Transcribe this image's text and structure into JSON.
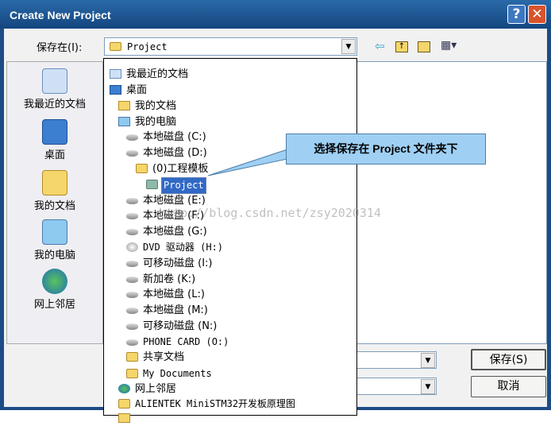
{
  "window": {
    "title": "Create New Project",
    "help": "?",
    "close": "✕"
  },
  "toolbar": {
    "savein_label": "保存在(I):",
    "savein_value": "Project",
    "icons": [
      "back-arrow-icon",
      "up-folder-icon",
      "new-folder-icon",
      "view-menu-icon"
    ]
  },
  "places": [
    {
      "label": "我最近的文档",
      "icon": "recent-docs-icon"
    },
    {
      "label": "桌面",
      "icon": "desktop-icon"
    },
    {
      "label": "我的文档",
      "icon": "my-documents-icon"
    },
    {
      "label": "我的电脑",
      "icon": "my-computer-icon"
    },
    {
      "label": "网上邻居",
      "icon": "network-icon"
    }
  ],
  "tree": [
    {
      "label": "我最近的文档",
      "icon": "recent-docs"
    },
    {
      "label": "桌面",
      "icon": "desktop"
    },
    {
      "label": "我的文档",
      "icon": "my-documents"
    },
    {
      "label": "我的电脑",
      "icon": "my-computer"
    },
    {
      "label": "本地磁盘 (C:)",
      "icon": "drive"
    },
    {
      "label": "本地磁盘 (D:)",
      "icon": "drive"
    },
    {
      "label": "(0)工程模板",
      "icon": "folder"
    },
    {
      "label": "Project",
      "icon": "folder-open",
      "selected": true
    },
    {
      "label": "本地磁盘 (E:)",
      "icon": "drive"
    },
    {
      "label": "本地磁盘 (F:)",
      "icon": "drive"
    },
    {
      "label": "本地磁盘 (G:)",
      "icon": "drive"
    },
    {
      "label": "DVD 驱动器 (H:)",
      "icon": "dvd"
    },
    {
      "label": "可移动磁盘 (I:)",
      "icon": "drive"
    },
    {
      "label": "新加卷 (K:)",
      "icon": "drive"
    },
    {
      "label": "本地磁盘 (L:)",
      "icon": "drive"
    },
    {
      "label": "本地磁盘 (M:)",
      "icon": "drive"
    },
    {
      "label": "可移动磁盘 (N:)",
      "icon": "drive"
    },
    {
      "label": "PHONE CARD (O:)",
      "icon": "drive"
    },
    {
      "label": "共享文档",
      "icon": "folder"
    },
    {
      "label": "My Documents",
      "icon": "folder"
    },
    {
      "label": "网上邻居",
      "icon": "network"
    },
    {
      "label": "ALIENTEK MiniSTM32开发板原理图",
      "icon": "folder"
    }
  ],
  "buttons": {
    "save": "保存(S)",
    "cancel": "取消"
  },
  "callout": "选择保存在 Project 文件夹下",
  "watermark": "http://blog.csdn.net/zsy2020314",
  "colors": {
    "titlebar": "#1c4d86",
    "selection": "#3169c6",
    "callout": "#9fd0f4"
  }
}
